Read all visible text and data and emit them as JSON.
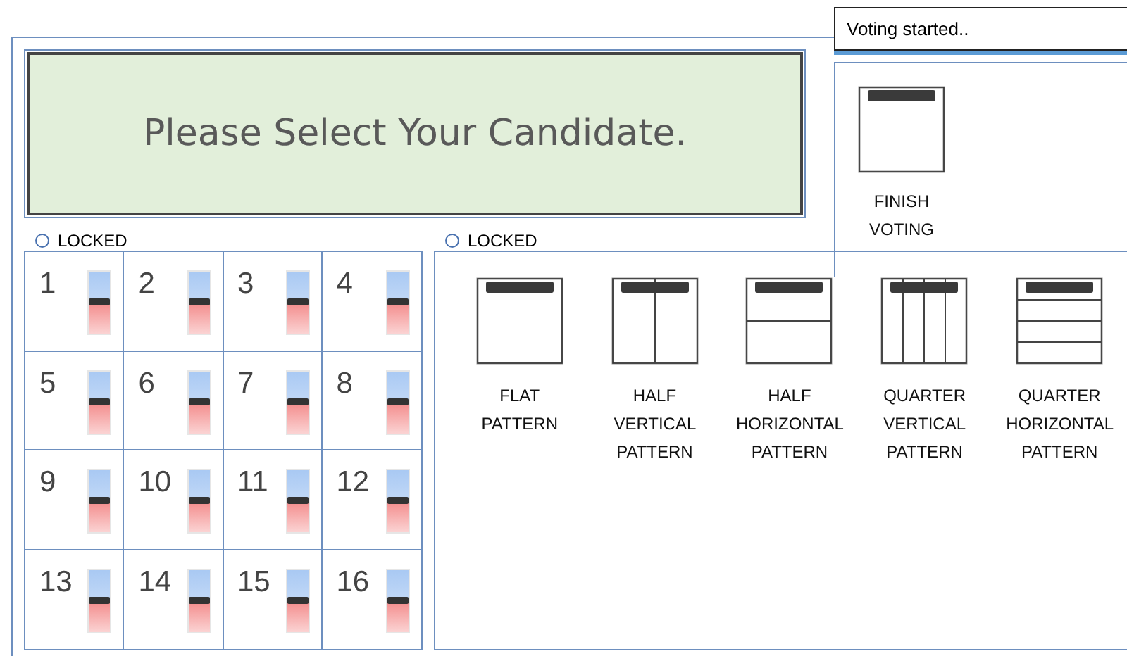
{
  "status": {
    "text": "Voting started.."
  },
  "message": {
    "text": "Please Select Your Candidate."
  },
  "finish_button": {
    "label": "FINISH VOTING"
  },
  "candidate_lock": {
    "label": "LOCKED",
    "checked": false
  },
  "pattern_lock": {
    "label": "LOCKED",
    "checked": false
  },
  "candidates": [
    {
      "number": "1",
      "level": 0.5
    },
    {
      "number": "2",
      "level": 0.5
    },
    {
      "number": "3",
      "level": 0.5
    },
    {
      "number": "4",
      "level": 0.5
    },
    {
      "number": "5",
      "level": 0.5
    },
    {
      "number": "6",
      "level": 0.5
    },
    {
      "number": "7",
      "level": 0.5
    },
    {
      "number": "8",
      "level": 0.5
    },
    {
      "number": "9",
      "level": 0.5
    },
    {
      "number": "10",
      "level": 0.5
    },
    {
      "number": "11",
      "level": 0.5
    },
    {
      "number": "12",
      "level": 0.5
    },
    {
      "number": "13",
      "level": 0.5
    },
    {
      "number": "14",
      "level": 0.5
    },
    {
      "number": "15",
      "level": 0.5
    },
    {
      "number": "16",
      "level": 0.5
    }
  ],
  "patterns": [
    {
      "kind": "flat",
      "label": "FLAT PATTERN"
    },
    {
      "kind": "half_vertical",
      "label": "HALF VERTICAL PATTERN"
    },
    {
      "kind": "half_horizontal",
      "label": "HALF HORIZONTAL PATTERN"
    },
    {
      "kind": "quarter_vertical",
      "label": "QUARTER VERTICAL PATTERN"
    },
    {
      "kind": "quarter_horizontal",
      "label": "QUARTER HORIZONTAL PATTERN"
    }
  ]
}
